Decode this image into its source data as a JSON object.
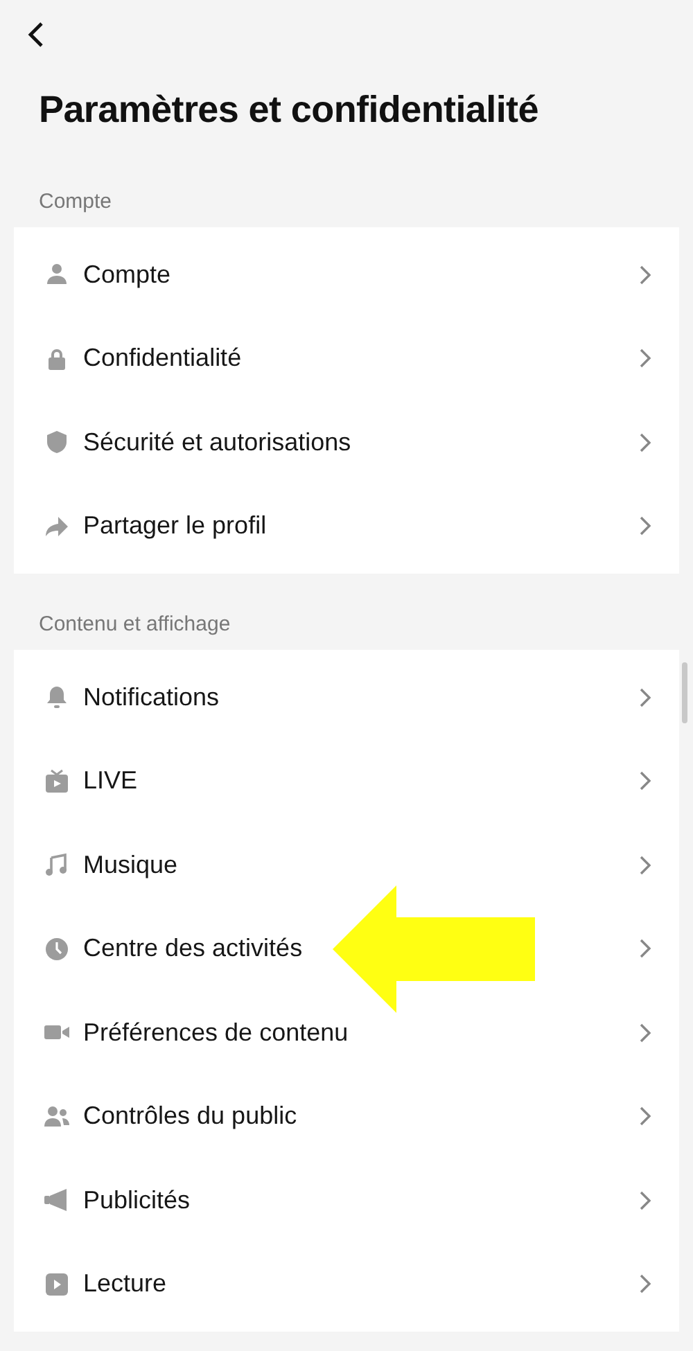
{
  "title": "Paramètres et confidentialité",
  "sections": [
    {
      "heading": "Compte",
      "items": [
        {
          "label": "Compte",
          "highlighted": false
        },
        {
          "label": "Confidentialité",
          "highlighted": false
        },
        {
          "label": "Sécurité et autorisations",
          "highlighted": false
        },
        {
          "label": "Partager le profil",
          "highlighted": false
        }
      ]
    },
    {
      "heading": "Contenu et affichage",
      "items": [
        {
          "label": "Notifications",
          "highlighted": false
        },
        {
          "label": "LIVE",
          "highlighted": false
        },
        {
          "label": "Musique",
          "highlighted": false
        },
        {
          "label": "Centre des activités",
          "highlighted": true
        },
        {
          "label": "Préférences de contenu",
          "highlighted": false
        },
        {
          "label": "Contrôles du public",
          "highlighted": false
        },
        {
          "label": "Publicités",
          "highlighted": false
        },
        {
          "label": "Lecture",
          "highlighted": false
        }
      ]
    }
  ]
}
